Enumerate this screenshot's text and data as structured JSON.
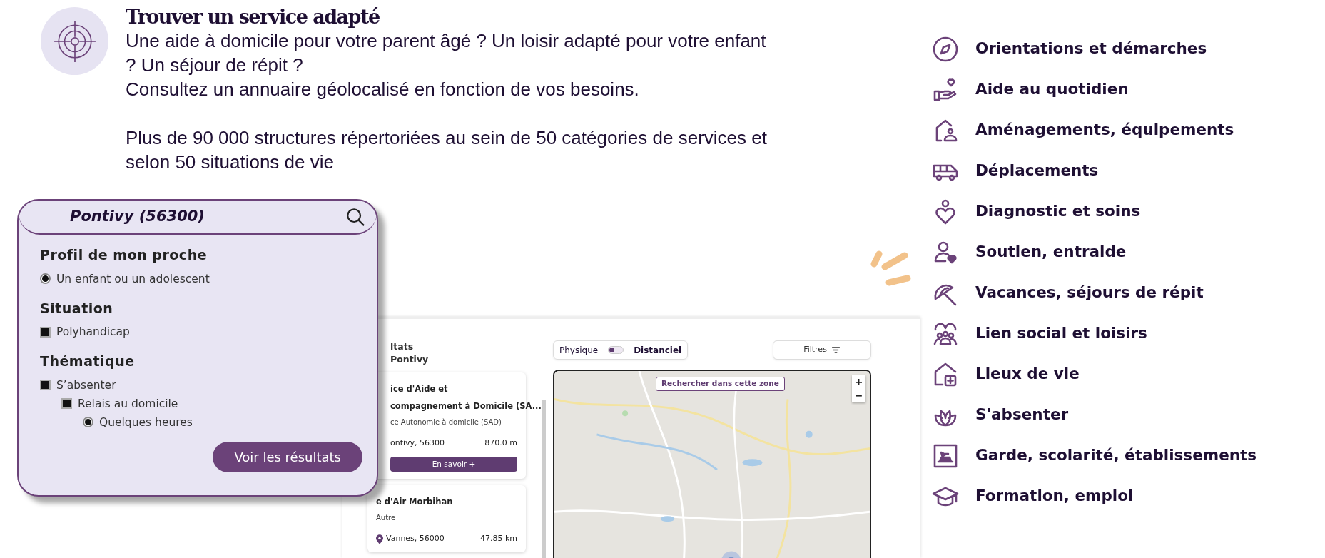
{
  "header": {
    "title": "Trouver un service adapté",
    "paragraphs": [
      [
        "Une aide à domicile pour votre parent âgé ? Un loisir adapté pour votre enfant ? Un séjour de répit ?",
        "Consultez un annuaire géolocalisé en fonction de vos besoins."
      ],
      [
        "Plus de 90 000 structures répertoriées au sein de 50 catégories de services et selon 50 situations de vie"
      ]
    ]
  },
  "search_card": {
    "location": "Pontivy (56300)",
    "sections": [
      {
        "heading": "Profil de mon proche",
        "options": [
          {
            "label": "Un enfant ou un adolescent",
            "kind": "radio",
            "selected": true
          }
        ]
      },
      {
        "heading": "Situation",
        "options": [
          {
            "label": "Polyhandicap",
            "kind": "checkbox",
            "checked": true
          }
        ]
      },
      {
        "heading": "Thématique",
        "options": [
          {
            "label": "S’absenter",
            "kind": "checkbox",
            "checked": true,
            "children": [
              {
                "label": "Relais au domicile",
                "kind": "checkbox",
                "checked": true,
                "children": [
                  {
                    "label": "Quelques heures",
                    "kind": "radio",
                    "selected": true
                  }
                ]
              }
            ]
          }
        ]
      }
    ],
    "button": "Voir les résultats"
  },
  "results_screen": {
    "heading": [
      "ltats",
      "Pontivy"
    ],
    "mode_toggle": {
      "left": "Physique",
      "right": "Distanciel",
      "on": false
    },
    "filters_button": "Filtres",
    "results": [
      {
        "title": [
          "ice d'Aide et",
          "compagnement à Domicile (SA..."
        ],
        "category": "ce Autonomie à domicile (SAD)",
        "place": "ontivy, 56300",
        "pin": false,
        "distance": "870.0 m",
        "button": "En savoir +"
      },
      {
        "title": [
          "e d'Air Morbihan"
        ],
        "category": "Autre",
        "place": "Vannes, 56000",
        "pin": true,
        "distance": "47.85 km"
      }
    ],
    "map": {
      "search_area_button": "Rechercher dans cette zone",
      "zoom_in": "+",
      "zoom_out": "−"
    }
  },
  "categories": [
    "Orientations et démarches",
    "Aide au quotidien",
    "Aménagements, équipements",
    "Déplacements",
    "Diagnostic et soins",
    "Soutien, entraide",
    "Vacances, séjours de répit",
    "Lien social et loisirs",
    "Lieux de vie",
    "S'absenter",
    "Garde, scolarité, établissements",
    "Formation, emploi"
  ]
}
